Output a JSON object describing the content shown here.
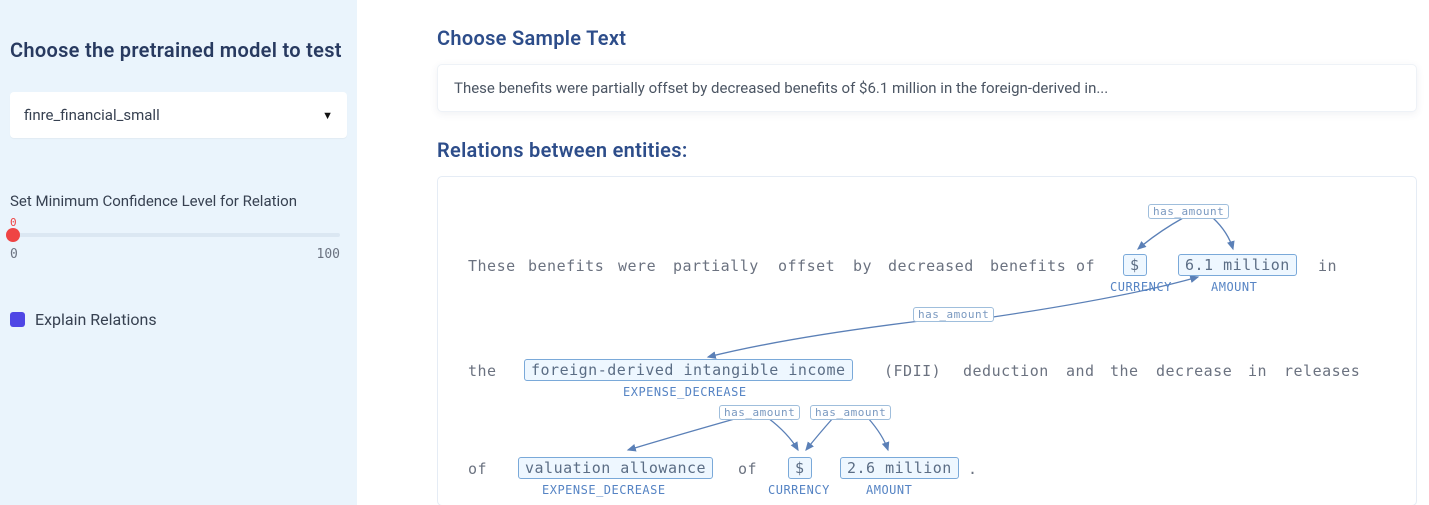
{
  "sidebar": {
    "choose_model_title": "Choose the pretrained model to test",
    "model_selected": "finre_financial_small",
    "confidence_label": "Set Minimum Confidence Level for Relation",
    "confidence_value": "0",
    "confidence_min": "0",
    "confidence_max": "100",
    "explain_label": "Explain Relations",
    "explain_checked": true
  },
  "main": {
    "sample_title": "Choose Sample Text",
    "sample_text": "These benefits were partially offset by decreased benefits of $6.1 million in the foreign-derived in...",
    "relations_title": "Relations between entities:"
  },
  "tokens": {
    "l1_these": "These",
    "l1_benefits": "benefits",
    "l1_were": "were",
    "l1_partially": "partially",
    "l1_offset": "offset",
    "l1_by": "by",
    "l1_decreased": "decreased",
    "l1_benefits2": "benefits",
    "l1_of": "of",
    "l1_dollar": "$",
    "l1_amount": "6.1 million",
    "l1_in": "in",
    "l2_the": "the",
    "l2_entity": "foreign-derived intangible income",
    "l2_fdii": "(FDII)",
    "l2_deduction": "deduction",
    "l2_and": "and",
    "l2_the2": "the",
    "l2_decrease": "decrease",
    "l2_in": "in",
    "l2_releases": "releases",
    "l3_of": "of",
    "l3_entity": "valuation allowance",
    "l3_of2": "of",
    "l3_dollar": "$",
    "l3_amount": "2.6 million",
    "l3_dot": "."
  },
  "etypes": {
    "currency": "CURRENCY",
    "amount": "AMOUNT",
    "expense_decrease": "EXPENSE_DECREASE"
  },
  "rels": {
    "has_amount": "has_amount"
  }
}
